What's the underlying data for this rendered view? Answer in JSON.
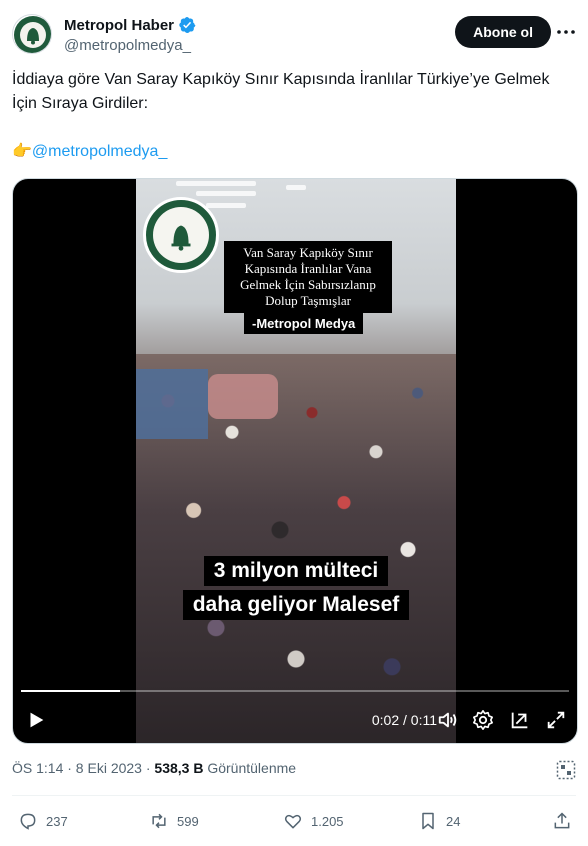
{
  "author": {
    "display_name": "Metropol Haber",
    "handle": "@metropolmedya_",
    "verified": true,
    "avatar_text": "Metropol Haber"
  },
  "subscribe_button": "Abone ol",
  "tweet": {
    "line1": "İddiaya göre Van Saray Kapıköy Sınır Kapısında İranlılar Türkiye’ye Gelmek İçin Sıraya Girdiler:",
    "pointer_emoji": "👉",
    "mention": "@metropolmedya_"
  },
  "video": {
    "logo_text": "Metropol Haber",
    "caption": "Van Saray Kapıköy Sınır Kapısında İranlılar Vana Gelmek İçin Sabırsızlanıp Dolup Taşmışlar",
    "caption_source": "-Metropol Medya",
    "overlay_line1": "3 milyon mülteci",
    "overlay_line2": "daha geliyor Malesef",
    "time_display": "0:02 / 0:11",
    "progress": 0.18
  },
  "meta": {
    "timestamp": "ÖS 1:14 · 8 Eki 2023 · ",
    "views": "538,3 B",
    "views_label": " Görüntülenme"
  },
  "actions": {
    "replies": "237",
    "reposts": "599",
    "likes": "1.205",
    "bookmarks": "24"
  },
  "colors": {
    "accent": "#1d9bf0",
    "text": "#0f1419",
    "muted": "#536471"
  }
}
